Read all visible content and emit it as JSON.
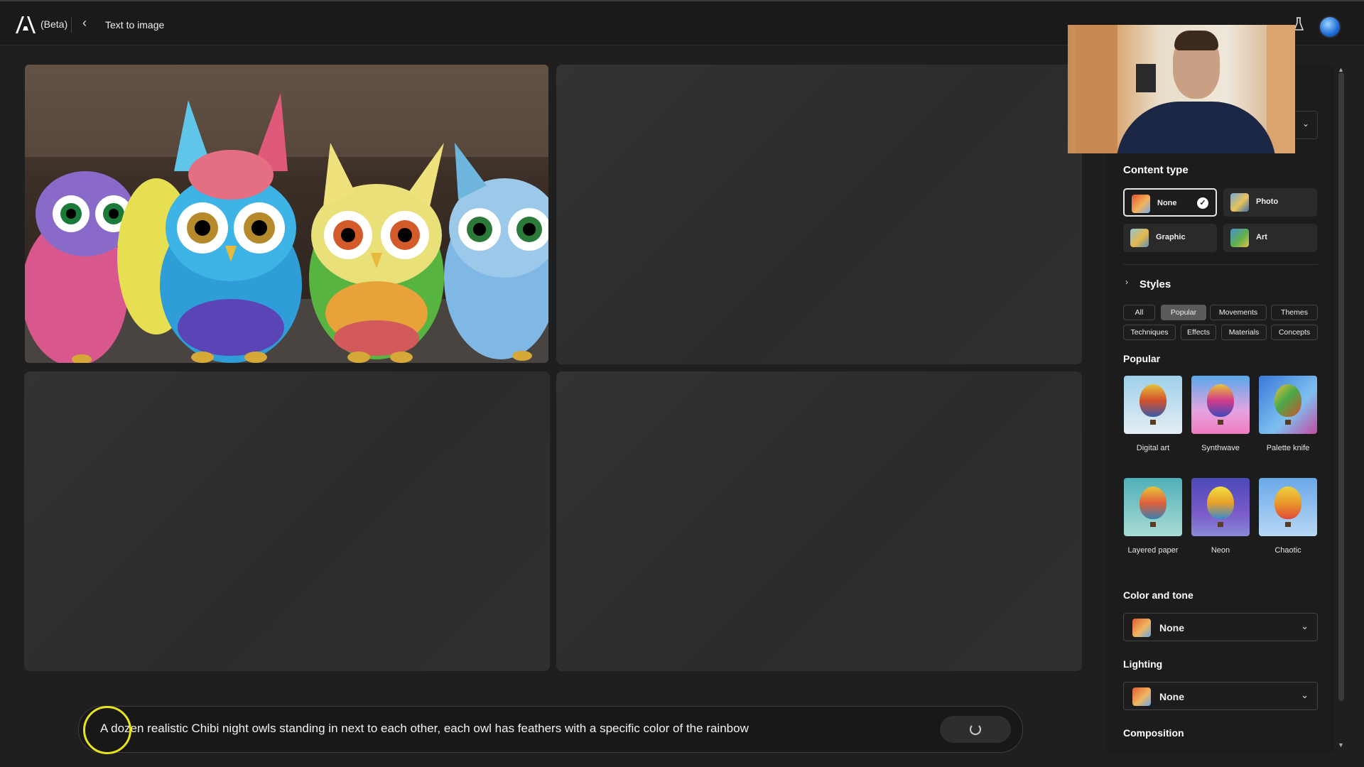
{
  "topbar": {
    "beta_label": "(Beta)",
    "breadcrumb": "Text to image",
    "back_icon": "chevron-left-icon",
    "logo_icon": "adobe-logo-icon",
    "lab_icon": "flask-icon",
    "avatar_icon": "avatar-icon"
  },
  "gallery": {
    "images": [
      {
        "state": "generated",
        "subject": "colorful chibi owls"
      },
      {
        "state": "placeholder"
      },
      {
        "state": "placeholder"
      },
      {
        "state": "placeholder"
      }
    ]
  },
  "prompt": {
    "text": "A dozen realistic Chibi night owls standing in next to each other, each owl has feathers with a specific color of the rainbow",
    "generate_state_icon": "loading-spinner-icon"
  },
  "panel": {
    "content_type": {
      "heading": "Content type",
      "options": [
        {
          "label": "None",
          "selected": true
        },
        {
          "label": "Photo",
          "selected": false
        },
        {
          "label": "Graphic",
          "selected": false
        },
        {
          "label": "Art",
          "selected": false
        }
      ]
    },
    "styles": {
      "heading": "Styles",
      "chips_row1": [
        "All",
        "Popular",
        "Movements",
        "Themes"
      ],
      "chips_row2": [
        "Techniques",
        "Effects",
        "Materials",
        "Concepts"
      ],
      "active_chip": "Popular",
      "section_heading": "Popular",
      "items": [
        "Digital art",
        "Synthwave",
        "Palette knife",
        "Layered paper",
        "Neon",
        "Chaotic"
      ]
    },
    "color_and_tone": {
      "heading": "Color and tone",
      "value": "None"
    },
    "lighting": {
      "heading": "Lighting",
      "value": "None"
    },
    "composition": {
      "heading": "Composition"
    }
  },
  "colors": {
    "accent_highlight": "#e6e41a",
    "background": "#1f1f1f",
    "panel": "#1c1c1c"
  }
}
